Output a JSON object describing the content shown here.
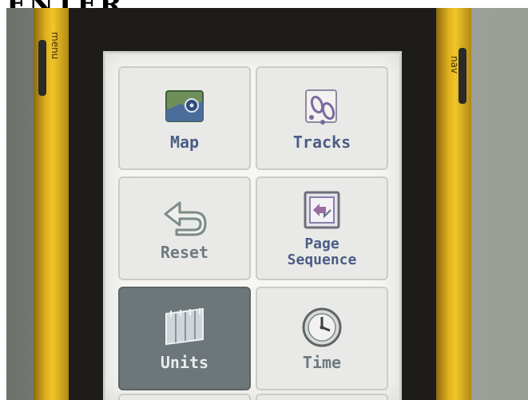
{
  "caption": {
    "text": "ENTER"
  },
  "device": {
    "left_button_label": "menu",
    "right_button_label": "nav"
  },
  "menu": {
    "tiles": [
      {
        "label": "Map",
        "icon": "map-icon"
      },
      {
        "label": "Tracks",
        "icon": "footprints-icon"
      },
      {
        "label": "Reset",
        "icon": "back-arrow-icon"
      },
      {
        "label": "Page",
        "label_line2": "Sequence",
        "icon": "page-sequence-icon"
      },
      {
        "label": "Units",
        "icon": "ruler-icon",
        "selected": true
      },
      {
        "label": "Time",
        "icon": "clock-icon"
      }
    ]
  },
  "colors": {
    "label_blue": "#4b5d86",
    "selected_tile": "#6d7779",
    "rail_yellow": "#f1c52a"
  }
}
